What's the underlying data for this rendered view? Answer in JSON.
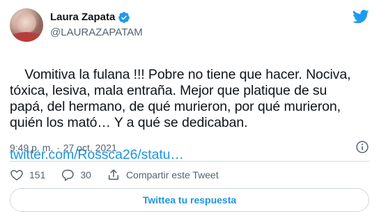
{
  "author": {
    "display_name": "Laura Zapata",
    "handle": "@LAURAZAPATAM",
    "verified": true,
    "avatar_icon": "user-avatar"
  },
  "brand": {
    "logo_icon": "twitter-bird-icon",
    "accent_color": "#1b95e0"
  },
  "tweet": {
    "text": "Vomitiva la fulana !!! Pobre no tiene que hacer. Nociva,\ntóxica, lesiva, mala entraña. Mejor que platique de su\npapá, del hermano, de qué murieron, por qué murieron,\nquién los mató… Y a qué se dedicaban.",
    "link": "twitter.com/Rossca26/statu…"
  },
  "meta": {
    "time": "9:49 p. m.",
    "separator": "·",
    "date": "27 oct. 2021"
  },
  "actions": {
    "likes": "151",
    "replies": "30",
    "share_label": "Compartir este Tweet"
  },
  "reply_button": {
    "label": "Twittea tu respuesta"
  }
}
